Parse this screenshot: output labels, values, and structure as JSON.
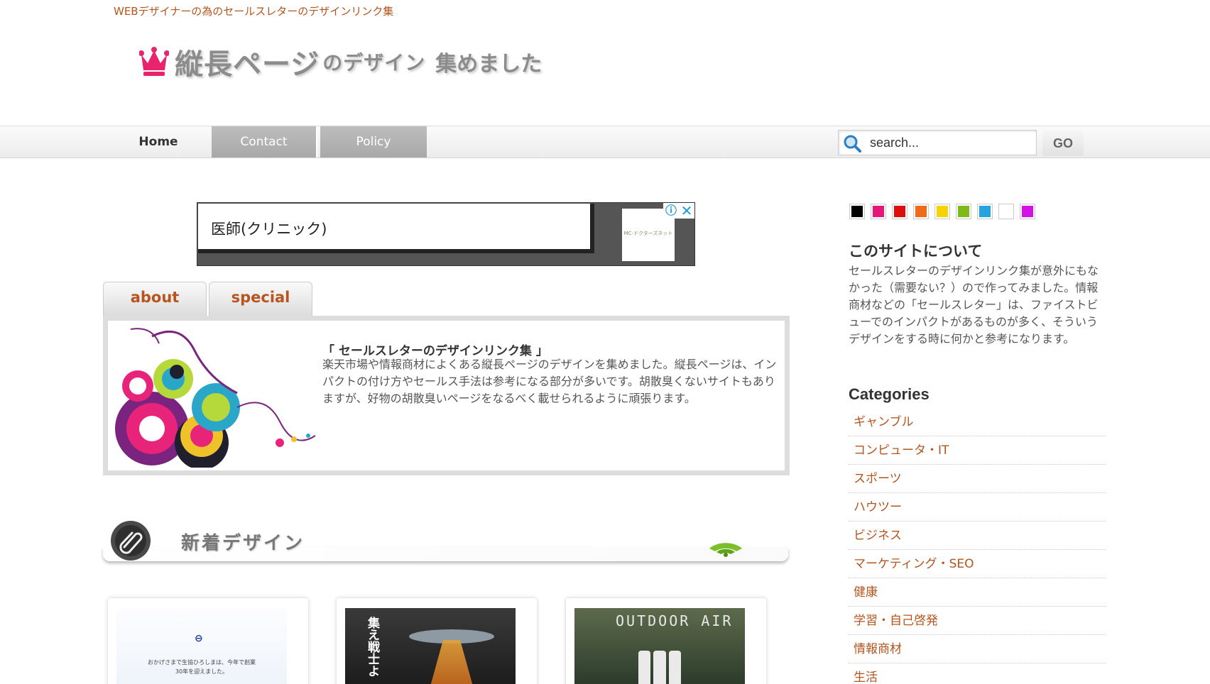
{
  "header": {
    "tagline": "WEBデザイナーの為のセールスレターのデザインリンク集",
    "logo_main": "縦長ページ",
    "logo_sub": "のデザイン",
    "logo_sub2": "集めました"
  },
  "nav": {
    "items": [
      {
        "label": "Home"
      },
      {
        "label": "Contact"
      },
      {
        "label": "Policy"
      }
    ]
  },
  "search": {
    "placeholder": "search...",
    "button_label": "GO"
  },
  "ad": {
    "text": "医師(クリニック)",
    "thumb_text": "MC-ドクターズネット"
  },
  "tabs": [
    {
      "label": "about"
    },
    {
      "label": "special"
    }
  ],
  "about_panel": {
    "title": "「 セールスレターのデザインリンク集 」",
    "body": "楽天市場や情報商材によくある縦長ページのデザインを集めました。縦長ページは、インパクトの付け方やセールス手法は参考になる部分が多いです。胡散臭くないサイトもありますが、好物の胡散臭いページをなるべく載せられるように頑張ります。"
  },
  "new_section": {
    "title": "新着デザイン"
  },
  "thumbnails": [
    {
      "logo": "⊖",
      "text": "おかげさまで生協ひろしまは、今年で創業30年を迎えました。"
    },
    {
      "text": "集え戦士よ"
    },
    {
      "text": "OUTDOOR AIR"
    }
  ],
  "sidebar": {
    "swatch_colors": [
      "#000000",
      "#e6157a",
      "#e00d0d",
      "#f06a1a",
      "#f5d400",
      "#7fba1b",
      "#26a4e0",
      "#ffffff",
      "#d512e6"
    ],
    "about_heading": "このサイトについて",
    "about_text": "セールスレターのデザインリンク集が意外にもなかった（需要ない？）ので作ってみました。情報商材などの「セールスレター」は、ファイストビューでのインパクトがあるものが多く、そういうデザインをする時に何かと参考になります。",
    "categories_heading": "Categories",
    "categories": [
      "ギャンブル",
      "コンピュータ・IT",
      "スポーツ",
      "ハウツー",
      "ビジネス",
      "マーケティング・SEO",
      "健康",
      "学習・自己啓発",
      "情報商材",
      "生活"
    ]
  }
}
